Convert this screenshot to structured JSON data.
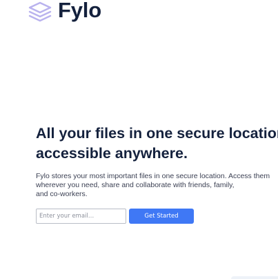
{
  "brand": {
    "name": "Fylo",
    "logo_icon": "stacked-layers-icon",
    "logo_color": "#b9b2ee"
  },
  "hero": {
    "title_lines": [
      "All your files in one secure location,",
      "accessible anywhere."
    ],
    "description_lines": [
      "Fylo stores your most important files in one secure location. Access them",
      "wherever you need, share and collaborate with friends, family,",
      "and co-workers."
    ]
  },
  "signup": {
    "email_placeholder": "Enter your email…",
    "email_value": "",
    "button_label": "Get Started",
    "button_color": "#3f78f5"
  },
  "colors": {
    "heading": "#14213d",
    "body_text": "#3a3f52",
    "background": "#ffffff"
  }
}
